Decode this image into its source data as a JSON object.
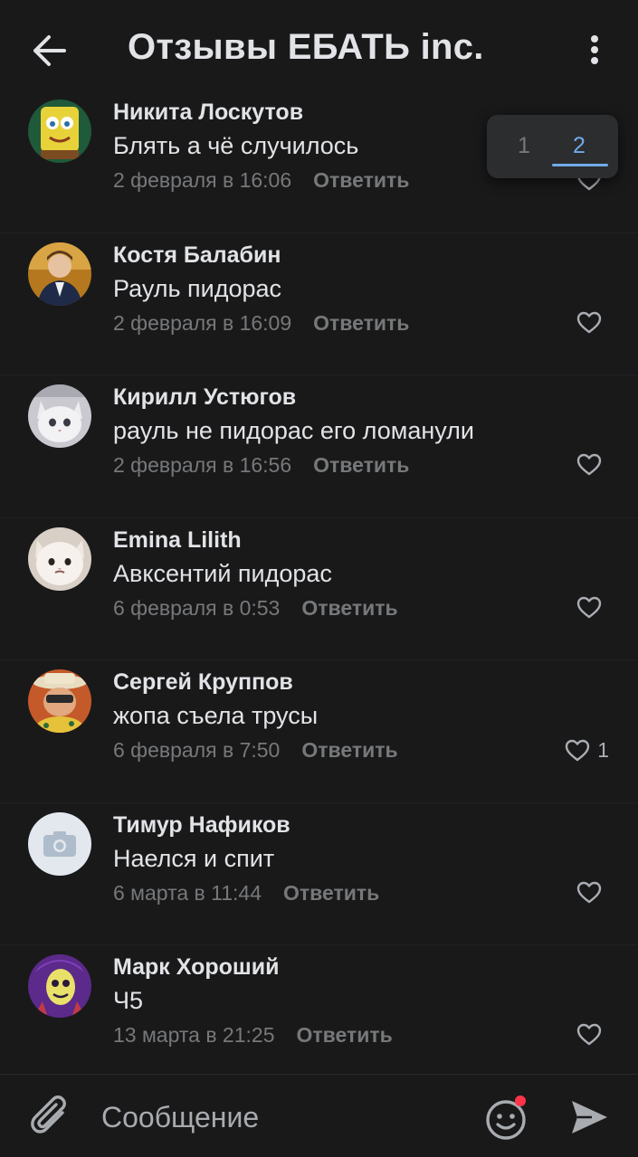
{
  "header": {
    "title": "Отзывы ЕБАТЬ inc.",
    "back_icon": "arrow-left-icon",
    "menu_icon": "more-vertical-icon"
  },
  "page_switch": {
    "pages": [
      "1",
      "2"
    ],
    "active": "2"
  },
  "comments": [
    {
      "author": "Никита Лоскутов",
      "text": "Блять а чё случилось",
      "date": "2 февраля в 16:06",
      "reply": "Ответить",
      "likes": ""
    },
    {
      "author": "Костя Балабин",
      "text": "Рауль пидорас",
      "date": "2 февраля в 16:09",
      "reply": "Ответить",
      "likes": ""
    },
    {
      "author": "Кирилл Устюгов",
      "text": "рауль не пидорас его ломанули",
      "date": "2 февраля в 16:56",
      "reply": "Ответить",
      "likes": ""
    },
    {
      "author": "Emina Lilith",
      "text": "Авксентий пидорас",
      "date": "6 февраля в 0:53",
      "reply": "Ответить",
      "likes": ""
    },
    {
      "author": "Сергей Круппов",
      "text": "жопа съела трусы",
      "date": "6 февраля в 7:50",
      "reply": "Ответить",
      "likes": "1"
    },
    {
      "author": "Тимур Нафиков",
      "text": "Наелся и спит",
      "date": "6 марта в 11:44",
      "reply": "Ответить",
      "likes": ""
    },
    {
      "author": "Марк Хороший",
      "text": "Ч5",
      "date": "13 марта в 21:25",
      "reply": "Ответить",
      "likes": ""
    }
  ],
  "composer": {
    "placeholder": "Сообщение",
    "attach_icon": "paperclip-icon",
    "emoji_icon": "smile-icon",
    "send_icon": "send-icon"
  },
  "colors": {
    "background": "#19191a",
    "text": "#e1e3e6",
    "secondary": "#76787a",
    "accent": "#71aaeb",
    "badge": "#ff3347"
  }
}
